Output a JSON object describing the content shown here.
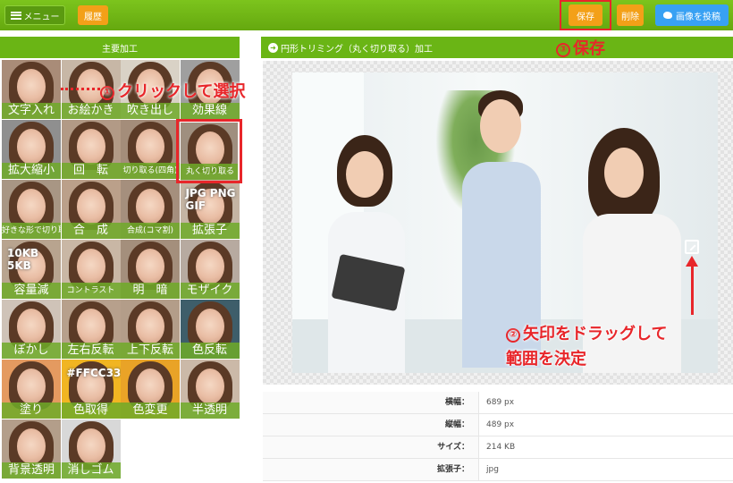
{
  "topbar": {
    "menu_label": "メニュー",
    "history_label": "履歴",
    "save_label": "保存",
    "delete_label": "削除",
    "tweet_label": "画像を投稿"
  },
  "left_panel": {
    "title": "主要加工",
    "tools": [
      {
        "label": "文字入れ"
      },
      {
        "label": "お絵かき"
      },
      {
        "label": "吹き出し"
      },
      {
        "label": "効果線"
      },
      {
        "label": "拡大縮小"
      },
      {
        "label": "回　転"
      },
      {
        "label": "切り取る(四角)"
      },
      {
        "label": "丸く切り取る"
      },
      {
        "label": "好きな形で切り取る"
      },
      {
        "label": "合　成"
      },
      {
        "label": "合成(コマ割)"
      },
      {
        "label": "拡張子",
        "overlay": "JPG PNG GIF"
      },
      {
        "label": "容量減",
        "overlay": "10KB 5KB"
      },
      {
        "label": "コントラスト"
      },
      {
        "label": "明　暗"
      },
      {
        "label": "モザイク"
      },
      {
        "label": "ぼかし"
      },
      {
        "label": "左右反転"
      },
      {
        "label": "上下反転"
      },
      {
        "label": "色反転"
      },
      {
        "label": "塗り"
      },
      {
        "label": "色取得",
        "overlay": "#FFCC33"
      },
      {
        "label": "色変更"
      },
      {
        "label": "半透明"
      },
      {
        "label": "背景透明"
      },
      {
        "label": "消しゴム"
      }
    ]
  },
  "main_panel": {
    "title": "円形トリミング（丸く切り取る）加工"
  },
  "annotations": {
    "step1": "クリックして選択",
    "step1_num": "①",
    "step2_line1": "矢印をドラッグして",
    "step2_line2": "範囲を決定",
    "step2_num": "②",
    "step3": "保存",
    "step3_num": "③"
  },
  "info": [
    {
      "key": "横幅：",
      "value": "689 px"
    },
    {
      "key": "縦幅：",
      "value": "489 px"
    },
    {
      "key": "サイズ：",
      "value": "214 KB"
    },
    {
      "key": "拡張子：",
      "value": "jpg"
    }
  ],
  "colors": {
    "green": "#6ab515",
    "orange": "#f3a018",
    "twitter_blue": "#38a1f3",
    "annotation_red": "#e8262a"
  }
}
